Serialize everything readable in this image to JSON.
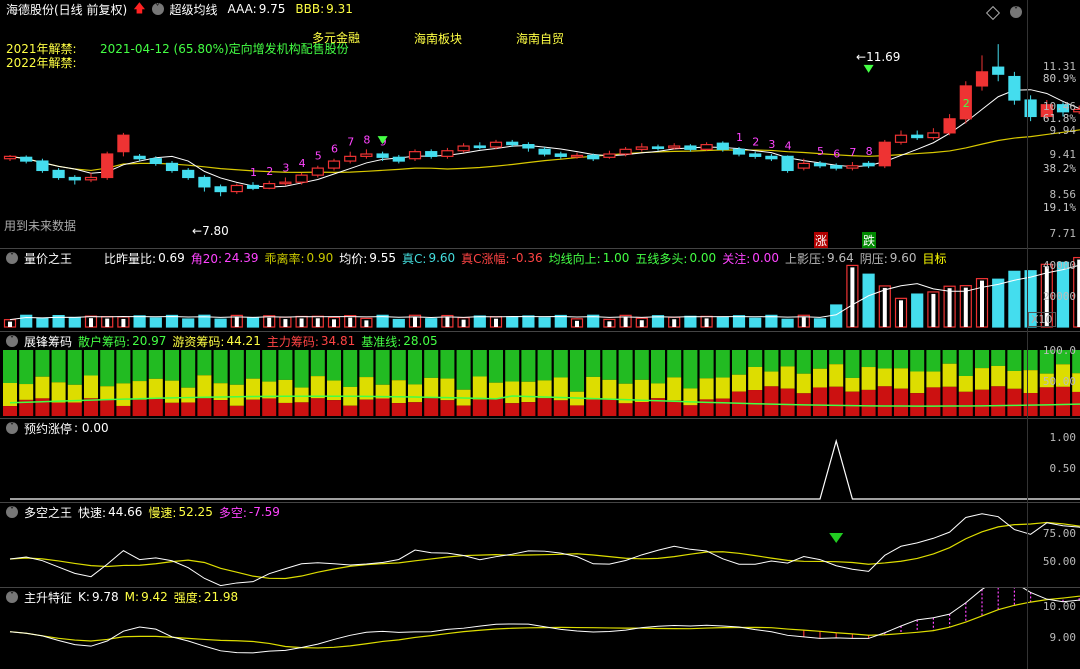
{
  "header": {
    "stock_name": "海德股份(日线 前复权)",
    "indicator": "超级均线",
    "aaa_label": "AAA:",
    "aaa_value": "9.75",
    "bbb_label": "BBB:",
    "bbb_value": "9.31",
    "unlock_2021": "2021年解禁:",
    "unlock_2021_note": "2021-04-12 (65.80%)定向增发机构配售股份",
    "unlock_2022": "2022年解禁:",
    "tags": [
      "多元金融",
      "海南板块",
      "海南自贸"
    ],
    "future_note": "用到未来数据",
    "low_label": "7.80",
    "high_label": "11.69",
    "zhang": "涨",
    "die": "跌"
  },
  "main_axis": [
    "11.31",
    "80.9%",
    "10.46",
    "61.8%",
    "9.94",
    "9.41",
    "38.2%",
    "8.56",
    "19.1%",
    "7.71"
  ],
  "panel2": {
    "title": "量价之王",
    "items": [
      {
        "label": "比昨量比:",
        "value": "0.69",
        "color": "#ffffff"
      },
      {
        "label": "角20:",
        "value": "24.39",
        "color": "#ff44ff"
      },
      {
        "label": "乖离率:",
        "value": "0.90",
        "color": "#c8c800"
      },
      {
        "label": "均价:",
        "value": "9.55",
        "color": "#ffffff"
      },
      {
        "label": "真C:",
        "value": "9.60",
        "color": "#44dddd"
      },
      {
        "label": "真C涨幅:",
        "value": "-0.36",
        "color": "#ff4444"
      },
      {
        "label": "均线向上:",
        "value": "1.00",
        "color": "#44ff44"
      },
      {
        "label": "五线多头:",
        "value": "0.00",
        "color": "#44ff44"
      },
      {
        "label": "关注:",
        "value": "0.00",
        "color": "#ff44ff"
      },
      {
        "label": "上影压:",
        "value": "9.64",
        "color": "#bbbbbb"
      },
      {
        "label": "阴压:",
        "value": "9.60",
        "color": "#bbbbbb"
      },
      {
        "label": "目标",
        "value": "",
        "color": "#ffff00"
      }
    ],
    "axis": [
      "40000",
      "20000"
    ],
    "unit": "X10"
  },
  "panel3": {
    "title": "展锋筹码",
    "items": [
      {
        "label": "散户筹码:",
        "value": "20.97",
        "color": "#44ff44"
      },
      {
        "label": "游资筹码:",
        "value": "44.21",
        "color": "#ffff44"
      },
      {
        "label": "主力筹码:",
        "value": "34.81",
        "color": "#ff4444"
      },
      {
        "label": "基准线:",
        "value": "28.05",
        "color": "#44ff44"
      }
    ],
    "axis": [
      "100.0",
      "50.00"
    ]
  },
  "panel4": {
    "title": "预约涨停",
    "value": ": 0.00",
    "axis": [
      "1.00",
      "0.50"
    ]
  },
  "panel5": {
    "title": "多空之王",
    "items": [
      {
        "label": "快速:",
        "value": "44.66",
        "color": "#ffffff"
      },
      {
        "label": "慢速:",
        "value": "52.25",
        "color": "#ffff44"
      },
      {
        "label": "多空:",
        "value": "-7.59",
        "color": "#ff44ff"
      }
    ],
    "axis": [
      "75.00",
      "50.00"
    ]
  },
  "panel6": {
    "title": "主升特征",
    "items": [
      {
        "label": "K:",
        "value": "9.78",
        "color": "#ffffff"
      },
      {
        "label": "M:",
        "value": "9.42",
        "color": "#ffff44"
      },
      {
        "label": "强度:",
        "value": "21.98",
        "color": "#ffff44"
      }
    ],
    "axis": [
      "10.00",
      "9.00"
    ]
  },
  "candles": [
    [
      9.25,
      9.3,
      9.33,
      9.2
    ],
    [
      9.28,
      9.2,
      9.32,
      9.15
    ],
    [
      9.2,
      9.0,
      9.25,
      8.95
    ],
    [
      9.0,
      8.85,
      9.05,
      8.8
    ],
    [
      8.85,
      8.8,
      8.9,
      8.7
    ],
    [
      8.8,
      8.85,
      8.95,
      8.75
    ],
    [
      8.85,
      9.35,
      9.4,
      8.8
    ],
    [
      9.4,
      9.75,
      9.8,
      9.3
    ],
    [
      9.3,
      9.25,
      9.35,
      9.2
    ],
    [
      9.25,
      9.15,
      9.3,
      9.1
    ],
    [
      9.15,
      9.0,
      9.2,
      8.95
    ],
    [
      9.0,
      8.85,
      9.05,
      8.8
    ],
    [
      8.85,
      8.65,
      8.9,
      8.55
    ],
    [
      8.65,
      8.55,
      8.7,
      8.45
    ],
    [
      8.55,
      8.68,
      8.72,
      8.5
    ],
    [
      8.68,
      8.62,
      8.75,
      8.58
    ],
    [
      8.62,
      8.72,
      8.78,
      8.6
    ],
    [
      8.72,
      8.75,
      8.85,
      8.68
    ],
    [
      8.75,
      8.9,
      8.95,
      8.7
    ],
    [
      8.9,
      9.05,
      9.1,
      8.85
    ],
    [
      9.05,
      9.2,
      9.25,
      9.0
    ],
    [
      9.2,
      9.3,
      9.4,
      9.15
    ],
    [
      9.3,
      9.35,
      9.45,
      9.25
    ],
    [
      9.35,
      9.28,
      9.4,
      9.2
    ],
    [
      9.28,
      9.2,
      9.33,
      9.15
    ],
    [
      9.25,
      9.4,
      9.45,
      9.2
    ],
    [
      9.4,
      9.3,
      9.45,
      9.25
    ],
    [
      9.3,
      9.42,
      9.48,
      9.25
    ],
    [
      9.42,
      9.52,
      9.58,
      9.38
    ],
    [
      9.52,
      9.5,
      9.6,
      9.45
    ],
    [
      9.5,
      9.6,
      9.65,
      9.45
    ],
    [
      9.6,
      9.55,
      9.65,
      9.5
    ],
    [
      9.55,
      9.48,
      9.6,
      9.4
    ],
    [
      9.45,
      9.35,
      9.5,
      9.3
    ],
    [
      9.35,
      9.3,
      9.4,
      9.25
    ],
    [
      9.3,
      9.32,
      9.38,
      9.25
    ],
    [
      9.32,
      9.25,
      9.36,
      9.2
    ],
    [
      9.28,
      9.35,
      9.42,
      9.25
    ],
    [
      9.35,
      9.45,
      9.5,
      9.3
    ],
    [
      9.45,
      9.5,
      9.58,
      9.4
    ],
    [
      9.5,
      9.48,
      9.55,
      9.42
    ],
    [
      9.48,
      9.52,
      9.58,
      9.45
    ],
    [
      9.52,
      9.45,
      9.56,
      9.4
    ],
    [
      9.45,
      9.55,
      9.6,
      9.42
    ],
    [
      9.58,
      9.45,
      9.62,
      9.4
    ],
    [
      9.45,
      9.35,
      9.5,
      9.3
    ],
    [
      9.35,
      9.3,
      9.4,
      9.25
    ],
    [
      9.3,
      9.25,
      9.35,
      9.2
    ],
    [
      9.3,
      9.0,
      9.32,
      8.95
    ],
    [
      9.05,
      9.15,
      9.25,
      9.0
    ],
    [
      9.15,
      9.1,
      9.2,
      9.05
    ],
    [
      9.1,
      9.05,
      9.15,
      9.0
    ],
    [
      9.05,
      9.1,
      9.18,
      9.0
    ],
    [
      9.15,
      9.1,
      9.2,
      9.05
    ],
    [
      9.1,
      9.6,
      9.65,
      9.05
    ],
    [
      9.6,
      9.75,
      9.85,
      9.55
    ],
    [
      9.75,
      9.7,
      9.85,
      9.65
    ],
    [
      9.7,
      9.8,
      9.9,
      9.65
    ],
    [
      9.8,
      10.1,
      10.2,
      9.75
    ],
    [
      10.1,
      10.8,
      10.9,
      10.0
    ],
    [
      10.8,
      11.1,
      11.45,
      10.7
    ],
    [
      11.2,
      11.05,
      11.69,
      10.9
    ],
    [
      11.0,
      10.5,
      11.1,
      10.4
    ],
    [
      10.5,
      10.15,
      10.6,
      10.05
    ],
    [
      10.15,
      10.4,
      10.5,
      10.1
    ],
    [
      10.4,
      10.25,
      10.45,
      10.15
    ],
    [
      10.25,
      10.3,
      10.38,
      10.2
    ],
    [
      10.3,
      10.35,
      10.45,
      10.25
    ],
    [
      10.4,
      10.2,
      10.42,
      10.1
    ],
    [
      10.15,
      9.9,
      10.2,
      9.85
    ],
    [
      9.9,
      9.8,
      9.95,
      9.75
    ]
  ]
}
